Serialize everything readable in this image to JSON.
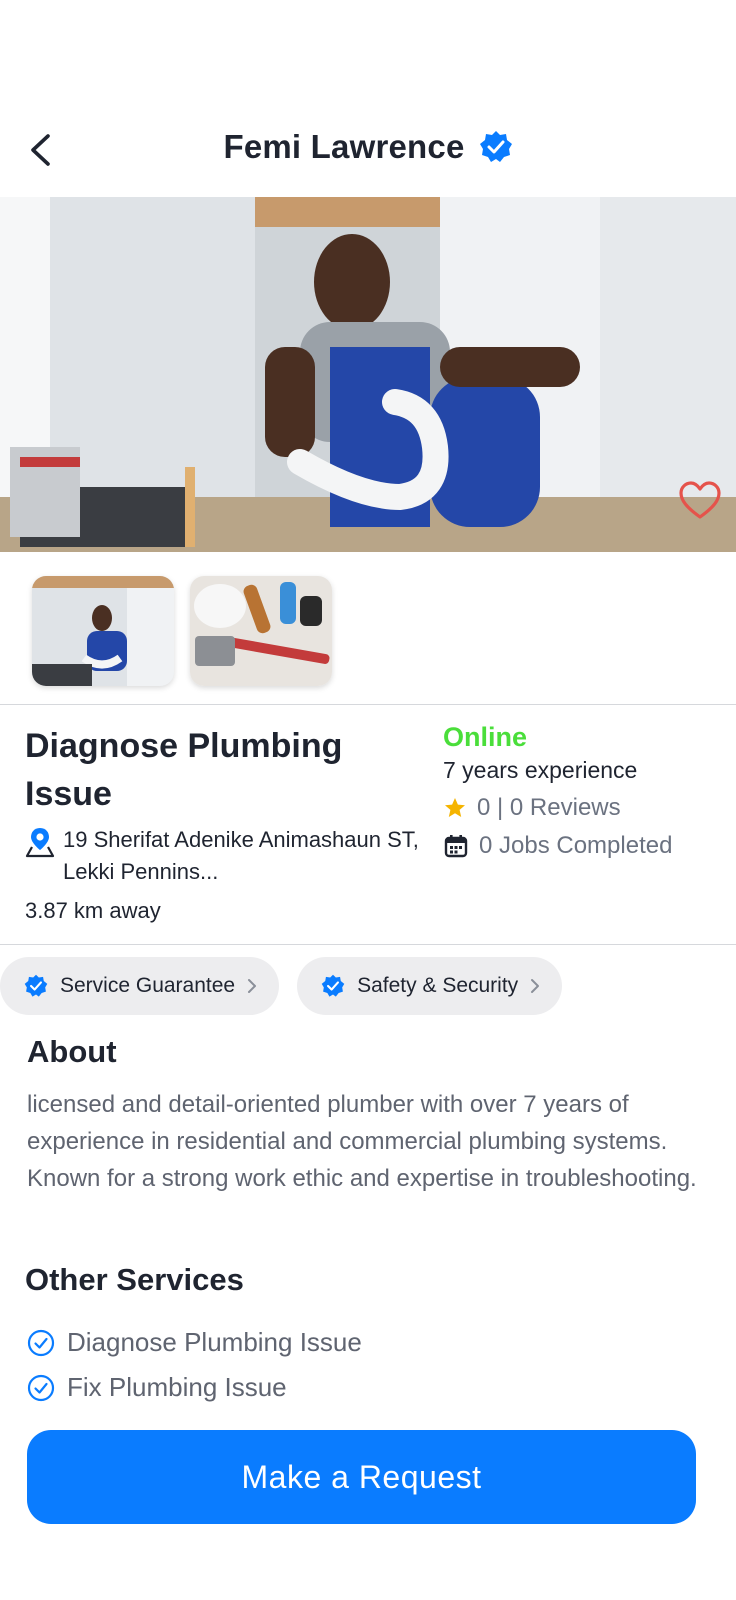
{
  "header": {
    "title": "Femi Lawrence",
    "back_icon": "chevron-left-icon",
    "verified_icon": "verified-badge-icon"
  },
  "hero": {
    "favorite_icon": "heart-outline-icon"
  },
  "thumbnails": [
    {
      "name": "thumbnail-plumber"
    },
    {
      "name": "thumbnail-tools"
    }
  ],
  "service": {
    "title": "Diagnose Plumbing Issue",
    "address": "19 Sherifat Adenike Animashaun ST, Lekki Pennins...",
    "distance": "3.87 km away"
  },
  "status": {
    "online": "Online",
    "experience": "7 years experience",
    "reviews": "0 | 0 Reviews",
    "jobs": "0 Jobs Completed"
  },
  "chips": [
    {
      "label": "Service Guarantee"
    },
    {
      "label": "Safety & Security"
    }
  ],
  "about": {
    "heading": "About",
    "text": "licensed and detail-oriented plumber with over 7 years of experience in residential and commercial plumbing systems. Known for a strong work ethic and expertise in troubleshooting."
  },
  "other_services": {
    "heading": "Other Services",
    "items": [
      "Diagnose Plumbing Issue",
      "Fix Plumbing Issue"
    ]
  },
  "cta": {
    "label": "Make a Request"
  },
  "colors": {
    "accent": "#0a7cff",
    "online": "#4ade3a",
    "star": "#f5b400",
    "heart": "#e5534b"
  }
}
